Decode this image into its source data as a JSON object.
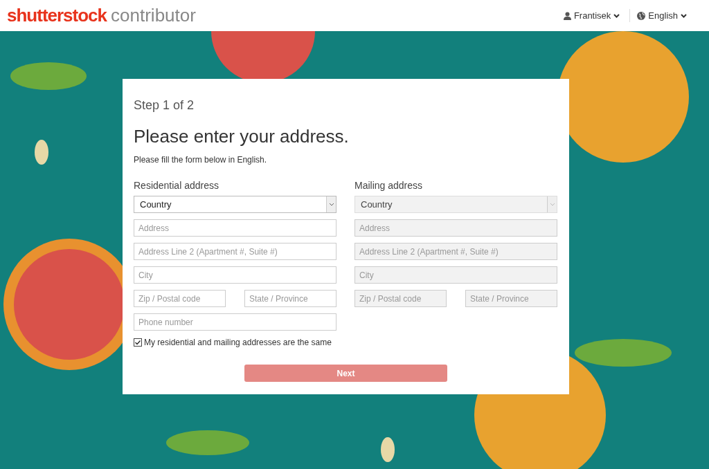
{
  "header": {
    "logo": "shutterstock",
    "logo_suffix": "contributor",
    "user": "Frantisek",
    "language": "English"
  },
  "form": {
    "step": "Step 1 of 2",
    "title": "Please enter your address.",
    "instruction": "Please fill the form below in English.",
    "sections": [
      {
        "title": "Residential address",
        "disabled": false,
        "rows": [
          {
            "kind": "select",
            "placeholder": "Country"
          },
          {
            "kind": "text",
            "placeholder": "Address"
          },
          {
            "kind": "text",
            "placeholder": "Address Line 2 (Apartment #, Suite #)"
          },
          {
            "kind": "text",
            "placeholder": "City"
          },
          {
            "kind": "pair",
            "fields": [
              {
                "placeholder": "Zip / Postal code"
              },
              {
                "placeholder": "State / Province"
              }
            ]
          },
          {
            "kind": "text",
            "placeholder": "Phone number"
          }
        ]
      },
      {
        "title": "Mailing address",
        "disabled": true,
        "rows": [
          {
            "kind": "select",
            "placeholder": "Country"
          },
          {
            "kind": "text",
            "placeholder": "Address"
          },
          {
            "kind": "text",
            "placeholder": "Address Line 2 (Apartment #, Suite #)"
          },
          {
            "kind": "text",
            "placeholder": "City"
          },
          {
            "kind": "pair",
            "fields": [
              {
                "placeholder": "Zip / Postal code"
              },
              {
                "placeholder": "State / Province"
              }
            ]
          }
        ]
      }
    ],
    "same_address": {
      "label": "My residential and mailing addresses are the same",
      "checked": true
    },
    "next_button": {
      "label": "Next",
      "disabled": true
    }
  }
}
